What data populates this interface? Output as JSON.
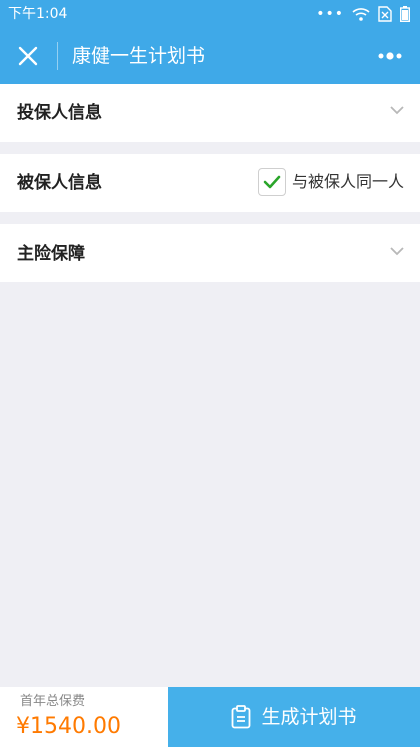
{
  "status_bar": {
    "time": "下午1:04",
    "dots": "•••"
  },
  "nav": {
    "title": "康健一生计划书"
  },
  "sections": {
    "applicant": {
      "title": "投保人信息"
    },
    "insured": {
      "title": "被保人信息",
      "same_person_label": "与被保人同一人",
      "same_person_checked": true
    },
    "main": {
      "title": "主险保障"
    }
  },
  "footer": {
    "premium_label": "首年总保费",
    "premium_value": "¥1540.00",
    "generate_label": "生成计划书"
  },
  "colors": {
    "primary": "#3fa9e8",
    "button": "#45b0ea",
    "price": "#ff7a00",
    "check": "#2aa52a",
    "background": "#efeff4"
  }
}
